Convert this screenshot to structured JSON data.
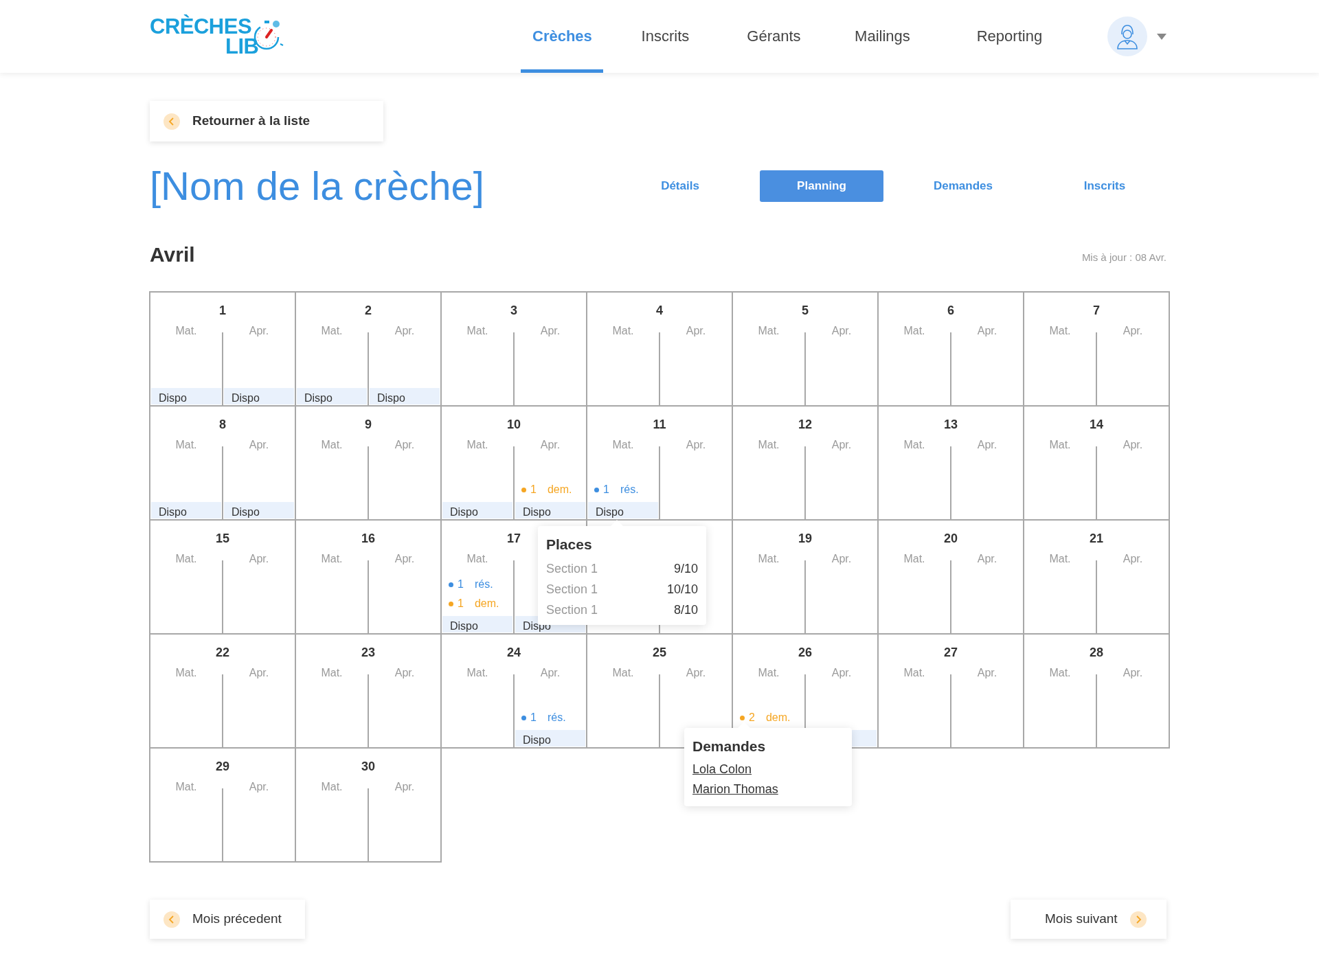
{
  "logo": {
    "line1": "CRÈCHES",
    "line2": "LIB"
  },
  "nav": [
    {
      "label": "Crèches",
      "selected": true
    },
    {
      "label": "Inscrits",
      "selected": false
    },
    {
      "label": "Gérants",
      "selected": false
    },
    {
      "label": "Mailings",
      "selected": false
    },
    {
      "label": "Reporting",
      "selected": false
    }
  ],
  "back_button": "Retourner à la liste",
  "title": "[Nom de la crèche]",
  "tabs": [
    {
      "label": "Détails",
      "selected": false
    },
    {
      "label": "Planning",
      "selected": true
    },
    {
      "label": "Demandes",
      "selected": false
    },
    {
      "label": "Inscrits",
      "selected": false
    }
  ],
  "month": "Avril",
  "updated": "Mis à jour : 08 Avr.",
  "days": [
    {
      "day": "1",
      "halves": [
        {
          "label": "Mat.",
          "dispo": true,
          "band_text": "Dispo"
        },
        {
          "label": "Apr.",
          "dispo": true,
          "band_text": "Dispo"
        }
      ]
    },
    {
      "day": "2",
      "halves": [
        {
          "label": "Mat.",
          "dispo": true,
          "band_text": "Dispo"
        },
        {
          "label": "Apr.",
          "dispo": true,
          "band_text": "Dispo"
        }
      ]
    },
    {
      "day": "3",
      "halves": [
        {
          "label": "Mat."
        },
        {
          "label": "Apr."
        }
      ]
    },
    {
      "day": "4",
      "halves": [
        {
          "label": "Mat."
        },
        {
          "label": "Apr."
        }
      ]
    },
    {
      "day": "5",
      "halves": [
        {
          "label": "Mat."
        },
        {
          "label": "Apr."
        }
      ]
    },
    {
      "day": "6",
      "halves": [
        {
          "label": "Mat."
        },
        {
          "label": "Apr."
        }
      ]
    },
    {
      "day": "7",
      "halves": [
        {
          "label": "Mat."
        },
        {
          "label": "Apr."
        }
      ]
    },
    {
      "day": "8",
      "halves": [
        {
          "label": "Mat.",
          "dispo": true,
          "band_text": "Dispo"
        },
        {
          "label": "Apr.",
          "dispo": true,
          "band_text": "Dispo"
        }
      ]
    },
    {
      "day": "9",
      "halves": [
        {
          "label": "Mat."
        },
        {
          "label": "Apr."
        }
      ]
    },
    {
      "day": "10",
      "halves": [
        {
          "label": "Mat.",
          "dispo": true,
          "band_text": "Dispo"
        },
        {
          "label": "Apr.",
          "items": [
            {
              "count": "1",
              "label": "dem.",
              "color": "#f5a623"
            }
          ],
          "dispo": true,
          "band_text": "Dispo"
        }
      ]
    },
    {
      "day": "11",
      "halves": [
        {
          "label": "Mat.",
          "items": [
            {
              "count": "1",
              "label": "rés.",
              "color": "#3d8ee0"
            }
          ],
          "dispo": true,
          "band_text": "Dispo"
        },
        {
          "label": "Apr."
        }
      ]
    },
    {
      "day": "12",
      "halves": [
        {
          "label": "Mat."
        },
        {
          "label": "Apr."
        }
      ]
    },
    {
      "day": "13",
      "halves": [
        {
          "label": "Mat."
        },
        {
          "label": "Apr."
        }
      ]
    },
    {
      "day": "14",
      "halves": [
        {
          "label": "Mat."
        },
        {
          "label": "Apr."
        }
      ]
    },
    {
      "day": "15",
      "halves": [
        {
          "label": "Mat."
        },
        {
          "label": "Apr."
        }
      ]
    },
    {
      "day": "16",
      "halves": [
        {
          "label": "Mat."
        },
        {
          "label": "Apr."
        }
      ]
    },
    {
      "day": "17",
      "halves": [
        {
          "label": "Mat.",
          "items": [
            {
              "count": "1",
              "label": "rés.",
              "color": "#3d8ee0"
            },
            {
              "count": "1",
              "label": "dem.",
              "color": "#f5a623"
            }
          ],
          "dispo": true,
          "band_text": "Dispo"
        },
        {
          "dispo": true,
          "band_text": "Dispo"
        }
      ]
    },
    {
      "covered": true
    },
    {
      "day": "19",
      "halves": [
        {
          "label": "Mat."
        },
        {
          "label": "Apr."
        }
      ]
    },
    {
      "day": "20",
      "halves": [
        {
          "label": "Mat."
        },
        {
          "label": "Apr."
        }
      ]
    },
    {
      "day": "21",
      "halves": [
        {
          "label": "Mat."
        },
        {
          "label": "Apr."
        }
      ]
    },
    {
      "day": "22",
      "halves": [
        {
          "label": "Mat."
        },
        {
          "label": "Apr."
        }
      ]
    },
    {
      "day": "23",
      "halves": [
        {
          "label": "Mat."
        },
        {
          "label": "Apr."
        }
      ]
    },
    {
      "day": "24",
      "halves": [
        {
          "label": "Mat."
        },
        {
          "label": "Apr.",
          "items": [
            {
              "count": "1",
              "label": "rés.",
              "color": "#3d8ee0"
            }
          ],
          "dispo": true,
          "band_text": "Dispo"
        }
      ]
    },
    {
      "day": "25",
      "halves": [
        {
          "label": "Mat."
        },
        {
          "label": "Apr."
        }
      ]
    },
    {
      "day": "26",
      "halves": [
        {
          "label": "Mat.",
          "items": [
            {
              "count": "2",
              "label": "dem.",
              "color": "#f5a623"
            }
          ]
        },
        {
          "label": "Apr.",
          "dispo": true
        }
      ]
    },
    {
      "day": "27",
      "halves": [
        {
          "label": "Mat."
        },
        {
          "label": "Apr."
        }
      ]
    },
    {
      "day": "28",
      "halves": [
        {
          "label": "Mat."
        },
        {
          "label": "Apr."
        }
      ]
    },
    {
      "day": "29",
      "halves": [
        {
          "label": "Mat."
        },
        {
          "label": "Apr."
        }
      ]
    },
    {
      "day": "30",
      "halves": [
        {
          "label": "Mat."
        },
        {
          "label": "Apr."
        }
      ]
    }
  ],
  "places_popover": {
    "title": "Places",
    "rows": [
      {
        "section": "Section 1",
        "value": "9/10"
      },
      {
        "section": "Section 1",
        "value": "10/10"
      },
      {
        "section": "Section 1",
        "value": "8/10"
      }
    ]
  },
  "demandes_popover": {
    "title": "Demandes",
    "links": [
      "Lola Colon",
      "Marion Thomas"
    ]
  },
  "prev_button": "Mois précedent",
  "next_button": "Mois suivant"
}
